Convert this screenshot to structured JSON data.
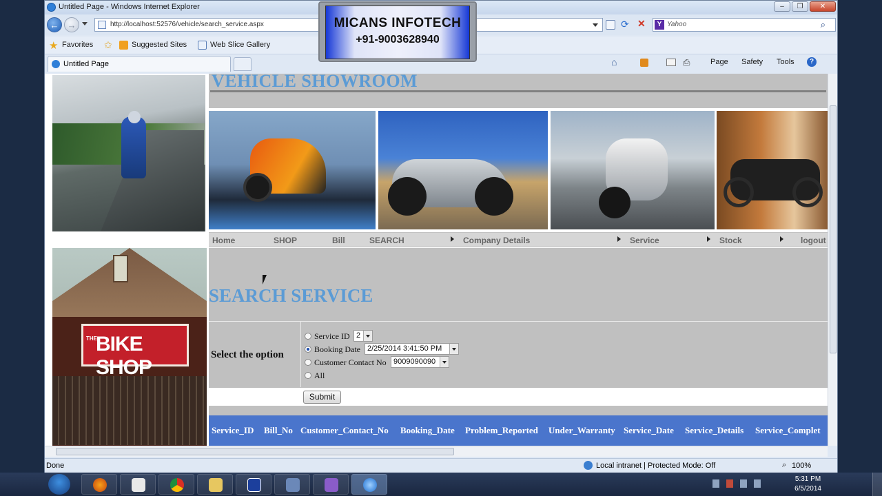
{
  "window": {
    "title": "Untitled Page - Windows Internet Explorer",
    "address": "http://localhost:52576/vehicle/search_service.aspx",
    "search_placeholder": "Yahoo",
    "tab_label": "Untitled Page"
  },
  "favorites": {
    "favorites_label": "Favorites",
    "suggested_sites": "Suggested Sites",
    "web_slice_gallery": "Web Slice Gallery"
  },
  "command_bar": {
    "page": "Page",
    "safety": "Safety",
    "tools": "Tools"
  },
  "overlay": {
    "line1": "MICANS INFOTECH",
    "line2": "+91-9003628940"
  },
  "page": {
    "banner_title": "VEHICLE SHOWROOM",
    "menu": [
      "Home",
      "SHOP",
      "Bill",
      "SEARCH",
      "Company Details",
      "Service",
      "Stock",
      "logout"
    ],
    "side_photo_sign": "BIKE SHOP",
    "side_photo_sign_prefix": "THE",
    "heading": "SEARCH SERVICE",
    "select_label": "Select the option",
    "options": {
      "service_id": {
        "label": "Service ID",
        "value": "2"
      },
      "booking_date": {
        "label": "Booking Date",
        "value": "2/25/2014 3:41:50 PM"
      },
      "contact": {
        "label": "Customer Contact No",
        "value": "9009090090"
      },
      "all": {
        "label": "All"
      }
    },
    "selected_option": "Booking Date",
    "submit_label": "Submit",
    "grid_headers": [
      "Service_ID",
      "Bill_No",
      "Customer_Contact_No",
      "Booking_Date",
      "Problem_Reported",
      "Under_Warranty",
      "Service_Date",
      "Service_Details",
      "Service_Complet"
    ]
  },
  "status": {
    "left": "Done",
    "zone": "Local intranet | Protected Mode: Off",
    "zoom": "100%"
  },
  "taskbar": {
    "time": "5:31 PM",
    "date": "6/5/2014"
  },
  "colors": {
    "heading_blue": "#5b9bd5",
    "grid_header_blue": "#4a75cc",
    "panel_grey": "#c0c0c0"
  }
}
